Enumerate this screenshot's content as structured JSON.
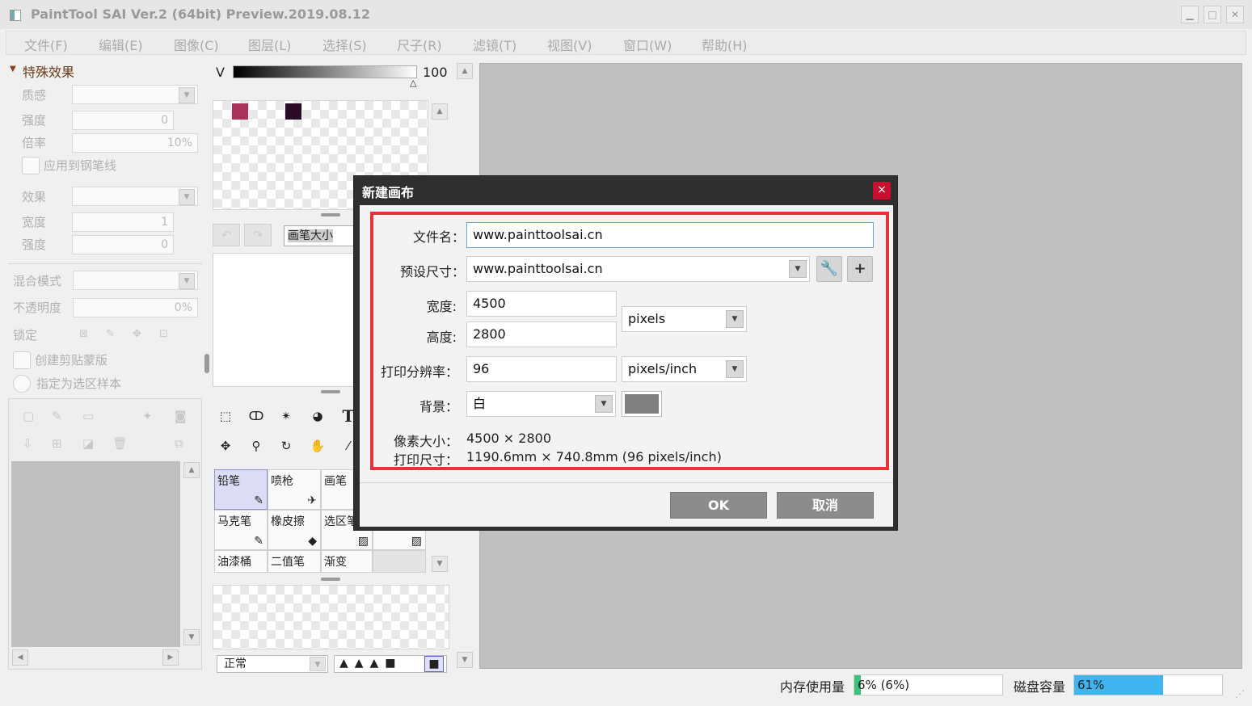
{
  "window": {
    "title": "PaintTool SAI Ver.2 (64bit) Preview.2019.08.12"
  },
  "menu": [
    "文件(F)",
    "编辑(E)",
    "图像(C)",
    "图层(L)",
    "选择(S)",
    "尺子(R)",
    "滤镜(T)",
    "视图(V)",
    "窗口(W)",
    "帮助(H)"
  ],
  "left_panel": {
    "section_title": "特殊效果",
    "texture_label": "质感",
    "strength_label": "强度",
    "strength_value": "0",
    "scale_label": "倍率",
    "scale_value": "10%",
    "apply_pen_label": "应用到钢笔线",
    "effect_label": "效果",
    "width_label": "宽度",
    "width_value": "1",
    "strength2_label": "强度",
    "strength2_value": "0",
    "blend_label": "混合模式",
    "opacity_label": "不透明度",
    "opacity_value": "0%",
    "lock_label": "锁定",
    "clip_label": "创建剪贴蒙版",
    "selection_label": "指定为选区样本"
  },
  "color_panel": {
    "channel": "V",
    "value": "100",
    "swatches": [
      "#a8325a",
      "#2a0a25"
    ]
  },
  "brush_size_label": "画笔大小",
  "tools": [
    {
      "label": "铅笔",
      "selected": true
    },
    {
      "label": "喷枪",
      "selected": false
    },
    {
      "label": "画笔",
      "selected": false
    },
    {
      "label": "马克笔",
      "selected": false
    },
    {
      "label": "橡皮擦",
      "selected": false
    },
    {
      "label": "选区笔",
      "selected": false
    },
    {
      "label": "油漆桶",
      "selected": false
    },
    {
      "label": "二值笔",
      "selected": false
    },
    {
      "label": "渐变",
      "selected": false
    }
  ],
  "brush_mode": "正常",
  "status": {
    "memory_label": "内存使用量",
    "memory_value": "6% (6%)",
    "memory_percent": 6,
    "disk_label": "磁盘容量",
    "disk_value": "61%",
    "disk_percent": 61
  },
  "dialog": {
    "title": "新建画布",
    "close": "×",
    "filename_label": "文件名：",
    "filename_value": "www.painttoolsai.cn",
    "preset_label": "预设尺寸：",
    "preset_value": "www.painttoolsai.cn",
    "width_label": "宽度:",
    "width_value": "4500",
    "height_label": "高度:",
    "height_value": "2800",
    "unit_value": "pixels",
    "dpi_label": "打印分辨率：",
    "dpi_value": "96",
    "dpi_unit": "pixels/inch",
    "bg_label": "背景：",
    "bg_value": "白",
    "pixel_size_label": "像素大小：",
    "pixel_size_value": "4500 × 2800",
    "print_size_label": "打印尺寸：",
    "print_size_value": "1190.6mm × 740.8mm (96 pixels/inch)",
    "ok_label": "OK",
    "cancel_label": "取消"
  }
}
